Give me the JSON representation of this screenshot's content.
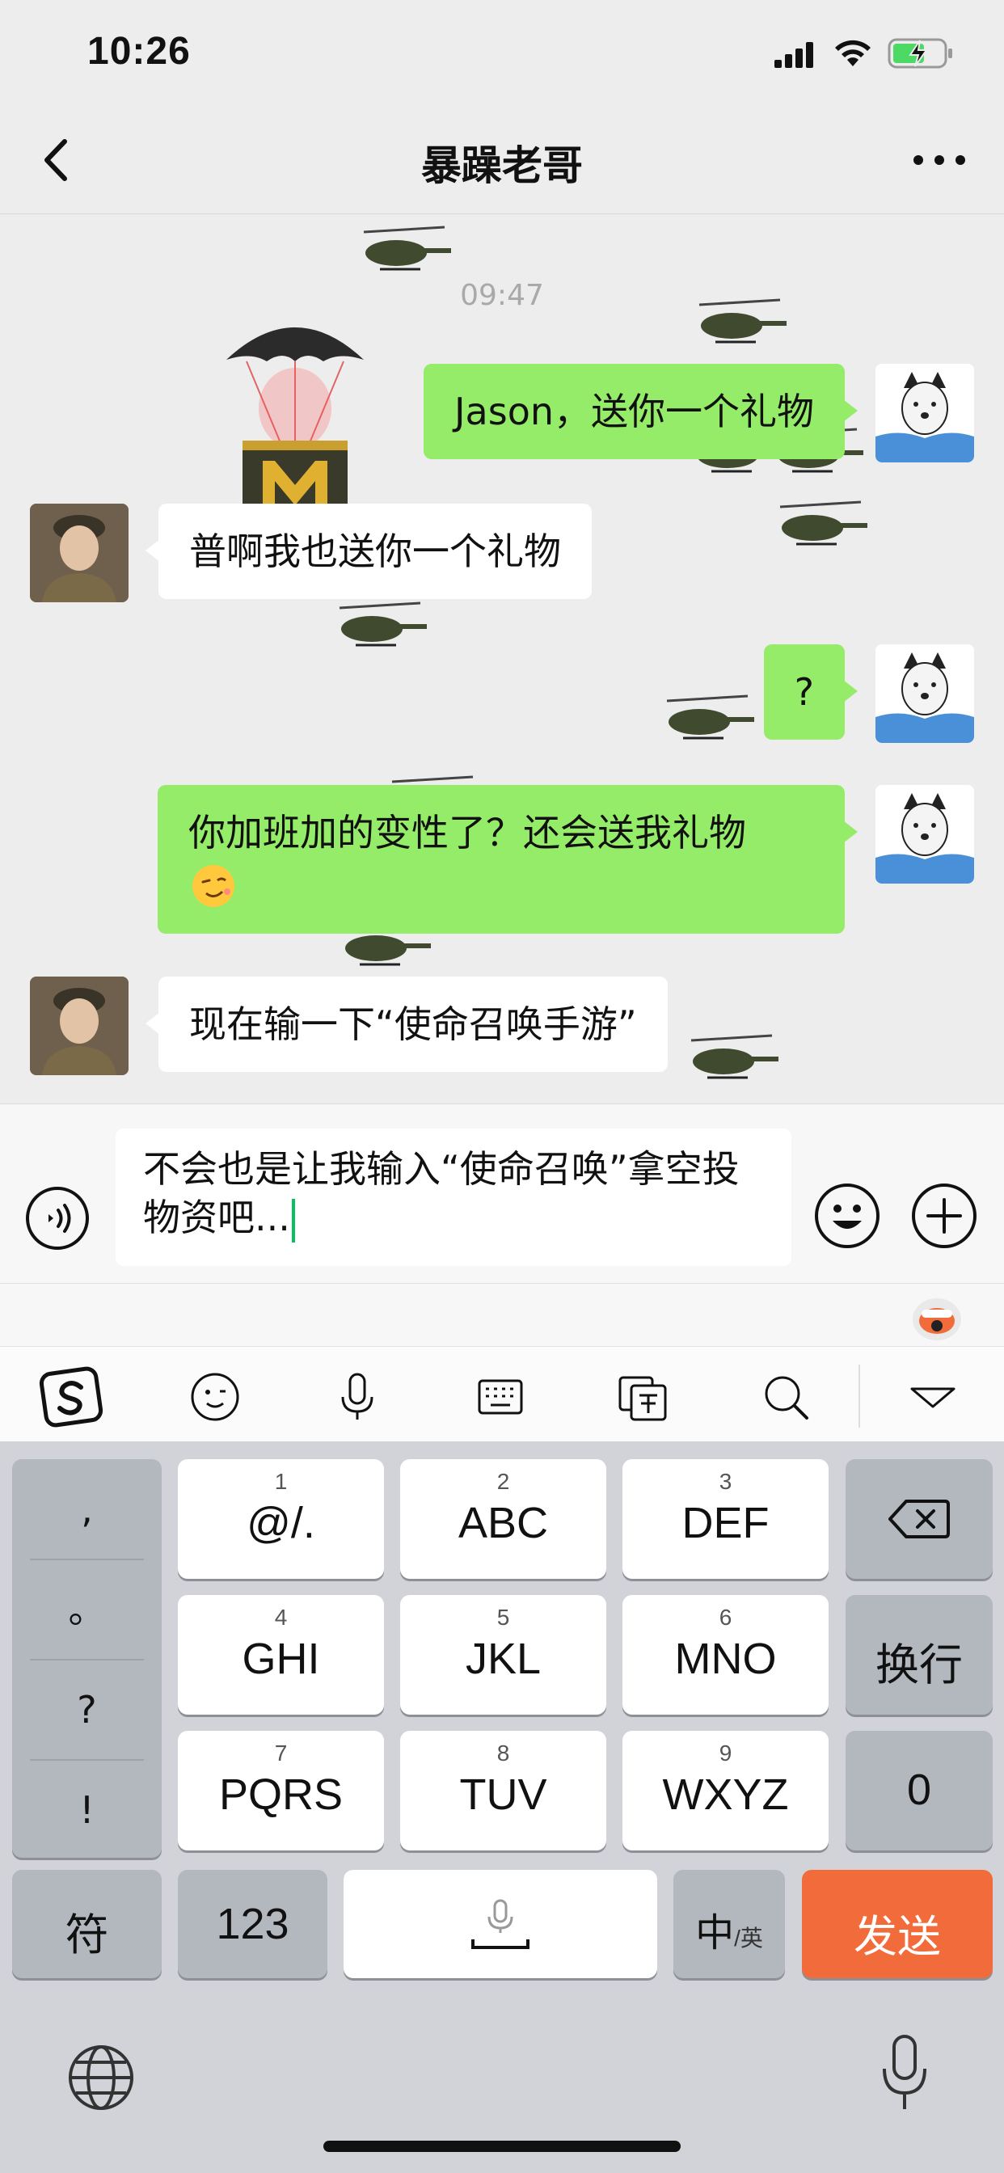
{
  "status": {
    "time": "10:26"
  },
  "nav": {
    "title": "暴躁老哥"
  },
  "chat": {
    "timestamp": "09:47",
    "messages": [
      {
        "side": "right",
        "text": "Jason，送你一个礼物"
      },
      {
        "side": "left",
        "text": "普啊我也送你一个礼物"
      },
      {
        "side": "right",
        "text": "?"
      },
      {
        "side": "right",
        "text": "你加班加的变性了？还会送我礼物"
      },
      {
        "side": "left",
        "text": "现在输一下“使命召唤手游”"
      }
    ]
  },
  "input": {
    "text": "不会也是让我输入“使命召唤”拿空投物资吧..."
  },
  "keyboard": {
    "punct": [
      ",",
      "。",
      "?",
      "!"
    ],
    "keys": [
      {
        "num": "1",
        "label": "@/."
      },
      {
        "num": "2",
        "label": "ABC"
      },
      {
        "num": "3",
        "label": "DEF"
      },
      {
        "num": "4",
        "label": "GHI"
      },
      {
        "num": "5",
        "label": "JKL"
      },
      {
        "num": "6",
        "label": "MNO"
      },
      {
        "num": "7",
        "label": "PQRS"
      },
      {
        "num": "8",
        "label": "TUV"
      },
      {
        "num": "9",
        "label": "WXYZ"
      }
    ],
    "newline": "换行",
    "zero": "0",
    "symbols": "符",
    "numbers": "123",
    "lang_zh": "中",
    "lang_en": "/英",
    "send": "发送"
  },
  "colors": {
    "bubble_green": "#95ec69",
    "send_orange": "#f26b3a",
    "caret": "#07c160"
  }
}
